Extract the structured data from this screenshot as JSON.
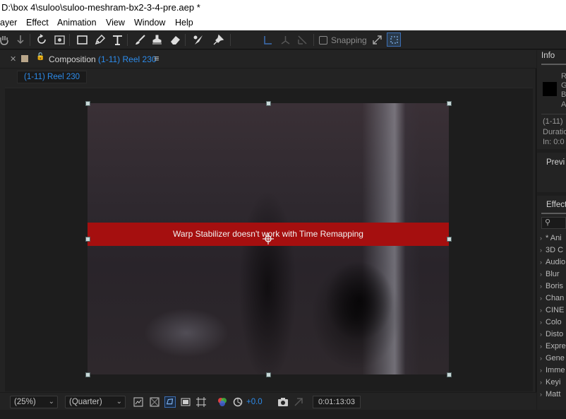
{
  "window": {
    "title": "D:\\box 4\\suloo\\suloo-meshram-bx2-3-4-pre.aep *"
  },
  "menu": {
    "items": [
      "ayer",
      "Effect",
      "Animation",
      "View",
      "Window",
      "Help"
    ]
  },
  "toolbar": {
    "snapping_label": "Snapping",
    "tools": [
      "home-icon",
      "select-arrow-icon",
      "hand-icon",
      "zoom-icon",
      "rotate-icon",
      "orbit-camera-icon",
      "rectangle-icon",
      "pen-icon",
      "type-icon",
      "brush-icon",
      "clone-stamp-icon",
      "eraser-icon",
      "roto-brush-icon",
      "puppet-pin-icon"
    ]
  },
  "composition": {
    "tab_label": "Composition",
    "tab_name": "(1-11) Reel 230",
    "breadcrumb": "(1-11) Reel 230",
    "warning": "Warp Stabilizer doesn't work with Time Remapping",
    "footer": {
      "magnification": "(25%)",
      "resolution": "(Quarter)",
      "exposure": "+0.0",
      "timecode": "0:01:13:03"
    }
  },
  "info_panel": {
    "tab": "Info",
    "channels": [
      "R",
      "G",
      "B",
      "A"
    ],
    "layer_name": "(1-11)",
    "duration_label": "Duratio",
    "in_label": "In: 0:0"
  },
  "preview_panel": {
    "tab": "Previ"
  },
  "effects_panel": {
    "tab": "Effects",
    "search_placeholder": "",
    "items": [
      "* Ani",
      "3D C",
      "Audio",
      "Blur",
      "Boris",
      "Chan",
      "CINE",
      "Colo",
      "Disto",
      "Expre",
      "Gene",
      "Imme",
      "Keyi",
      "Matt"
    ]
  },
  "colors": {
    "accent": "#2d8ceb",
    "warning_bg": "#a50f0f",
    "panel": "#232323"
  }
}
